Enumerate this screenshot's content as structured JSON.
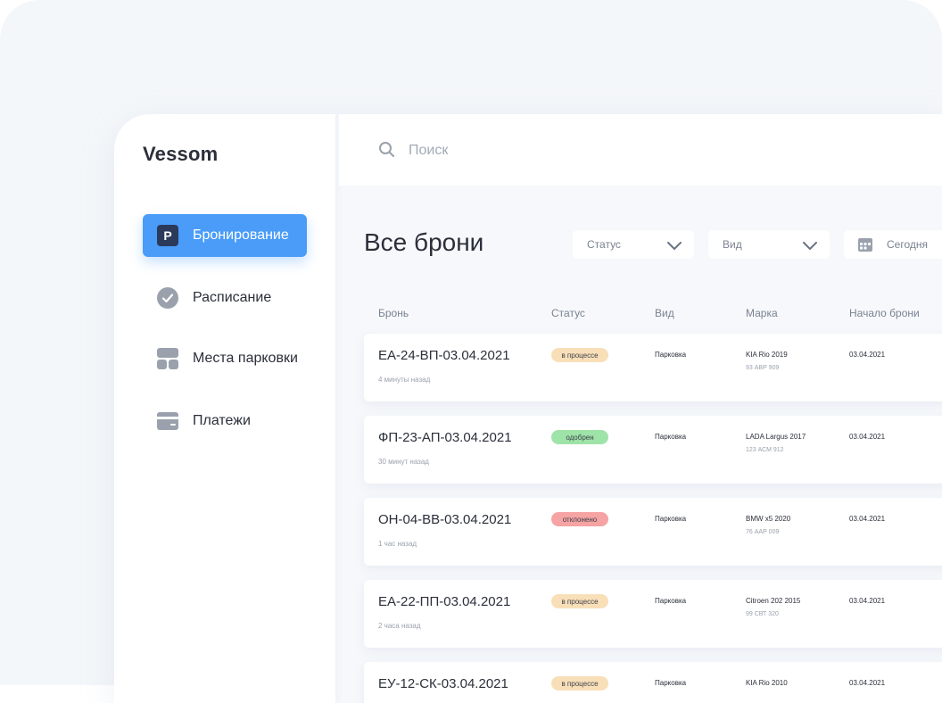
{
  "app": {
    "logo": "Vessom"
  },
  "sidebar": {
    "items": [
      {
        "label": "Бронирование",
        "icon": "parking-icon",
        "active": true
      },
      {
        "label": "Расписание",
        "icon": "check-circle-icon",
        "active": false
      },
      {
        "label": "Места парковки",
        "icon": "grid-icon",
        "active": false
      },
      {
        "label": "Платежи",
        "icon": "card-icon",
        "active": false
      }
    ],
    "parking_badge": "P"
  },
  "search": {
    "placeholder": "Поиск",
    "value": ""
  },
  "main": {
    "title": "Все брони",
    "filters": [
      {
        "label": "Статус",
        "icon": "chevron-down-icon"
      },
      {
        "label": "Вид",
        "icon": "chevron-down-icon"
      },
      {
        "label": "Сегодня",
        "icon": "calendar-icon"
      }
    ],
    "columns": [
      "Бронь",
      "Статус",
      "Вид",
      "Марка",
      "Начало брони"
    ],
    "rows": [
      {
        "code": "ЕА-24-ВП-03.04.2021",
        "ago": "4 минуты назад",
        "status": "в процессе",
        "status_color": "#f9dfb8",
        "kind": "Парковка",
        "car": "KIA Rio 2019",
        "plate": "93 АВР 909",
        "start": "03.04.2021"
      },
      {
        "code": "ФП-23-АП-03.04.2021",
        "ago": "30 минут назад",
        "status": "одобрен",
        "status_color": "#9ee3a8",
        "kind": "Парковка",
        "car": "LADA Largus 2017",
        "plate": "123 АСМ 912",
        "start": "03.04.2021"
      },
      {
        "code": "ОН-04-ВВ-03.04.2021",
        "ago": "1 час назад",
        "status": "отклонено",
        "status_color": "#f6a3a3",
        "kind": "Парковка",
        "car": "BMW x5 2020",
        "plate": "76 ААР 009",
        "start": "03.04.2021"
      },
      {
        "code": "ЕА-22-ПП-03.04.2021",
        "ago": "2 часа назад",
        "status": "в процессе",
        "status_color": "#f9dfb8",
        "kind": "Парковка",
        "car": "Citroen 202 2015",
        "plate": "99 СВТ 320",
        "start": "03.04.2021"
      },
      {
        "code": "ЕУ-12-СК-03.04.2021",
        "ago": "",
        "status": "в процессе",
        "status_color": "#f9dfb8",
        "kind": "Парковка",
        "car": "KIA Rio 2010",
        "plate": "",
        "start": "03.04.2021"
      }
    ]
  },
  "colors": {
    "accent": "#4a9cf8",
    "text": "#2b2f3a",
    "muted": "#7a8291"
  }
}
